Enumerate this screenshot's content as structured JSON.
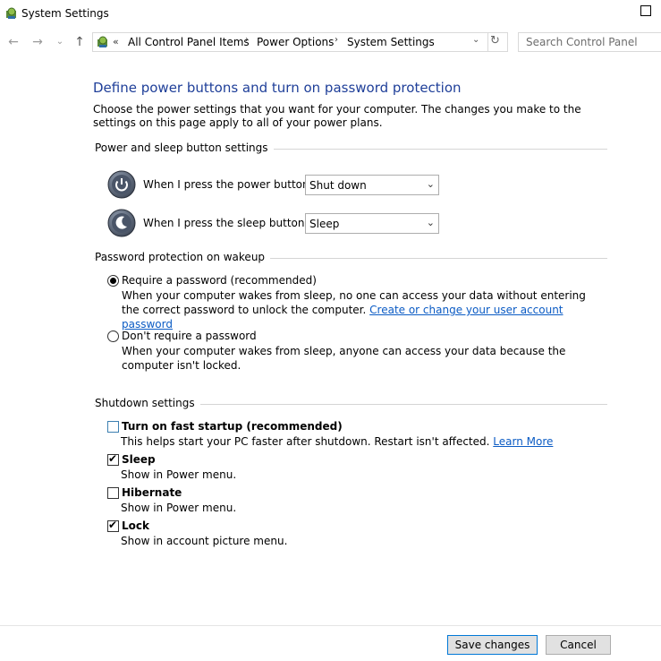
{
  "window": {
    "title": "System Settings"
  },
  "address_bar": {
    "chevron": "«",
    "crumbs": [
      "All Control Panel Items",
      "Power Options",
      "System Settings"
    ],
    "separator": "›"
  },
  "search": {
    "placeholder": "Search Control Panel"
  },
  "main": {
    "heading": "Define power buttons and turn on password protection",
    "description": "Choose the power settings that you want for your computer. The changes you make to the settings on this page apply to all of your power plans."
  },
  "power_section": {
    "title": "Power and sleep button settings",
    "power_button_label": "When I press the power button:",
    "power_button_value": "Shut down",
    "sleep_button_label": "When I press the sleep button:",
    "sleep_button_value": "Sleep"
  },
  "password_section": {
    "title": "Password protection on wakeup",
    "require_label": "Require a password (recommended)",
    "require_desc": "When your computer wakes from sleep, no one can access your data without entering the correct password to unlock the computer.",
    "require_link": "Create or change your user account password",
    "require_selected": true,
    "no_require_label": "Don't require a password",
    "no_require_desc": "When your computer wakes from sleep, anyone can access your data because the computer isn't locked."
  },
  "shutdown_section": {
    "title": "Shutdown settings",
    "fast_startup_label": "Turn on fast startup (recommended)",
    "fast_startup_desc": "This helps start your PC faster after shutdown. Restart isn't affected.",
    "fast_startup_link": "Learn More",
    "fast_startup_checked": false,
    "sleep_label": "Sleep",
    "sleep_desc": "Show in Power menu.",
    "sleep_checked": true,
    "hibernate_label": "Hibernate",
    "hibernate_desc": "Show in Power menu.",
    "hibernate_checked": false,
    "lock_label": "Lock",
    "lock_desc": "Show in account picture menu.",
    "lock_checked": true
  },
  "footer": {
    "save_label": "Save changes",
    "cancel_label": "Cancel"
  },
  "colors": {
    "heading": "#1f3f99",
    "link": "#0b5bc4",
    "primary_border": "#0078d7"
  }
}
